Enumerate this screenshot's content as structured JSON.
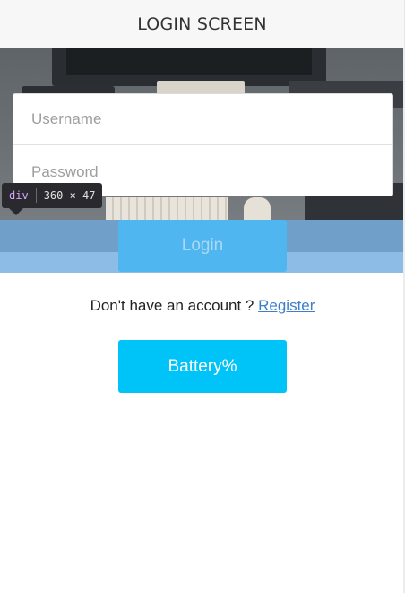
{
  "header": {
    "title": "LOGIN SCREEN"
  },
  "form": {
    "username_placeholder": "Username",
    "password_placeholder": "Password",
    "login_label": "Login"
  },
  "devtools_tooltip": {
    "tag": "div",
    "dimensions": "360 × 47"
  },
  "register": {
    "prompt": "Don't have an account ?",
    "link_label": "Register"
  },
  "battery_button": {
    "label": "Battery%"
  },
  "colors": {
    "header_bg": "#f7f7f7",
    "login_button": "#4fb6f0",
    "battery_button": "#00c3f7",
    "link": "#3f7fc7"
  }
}
